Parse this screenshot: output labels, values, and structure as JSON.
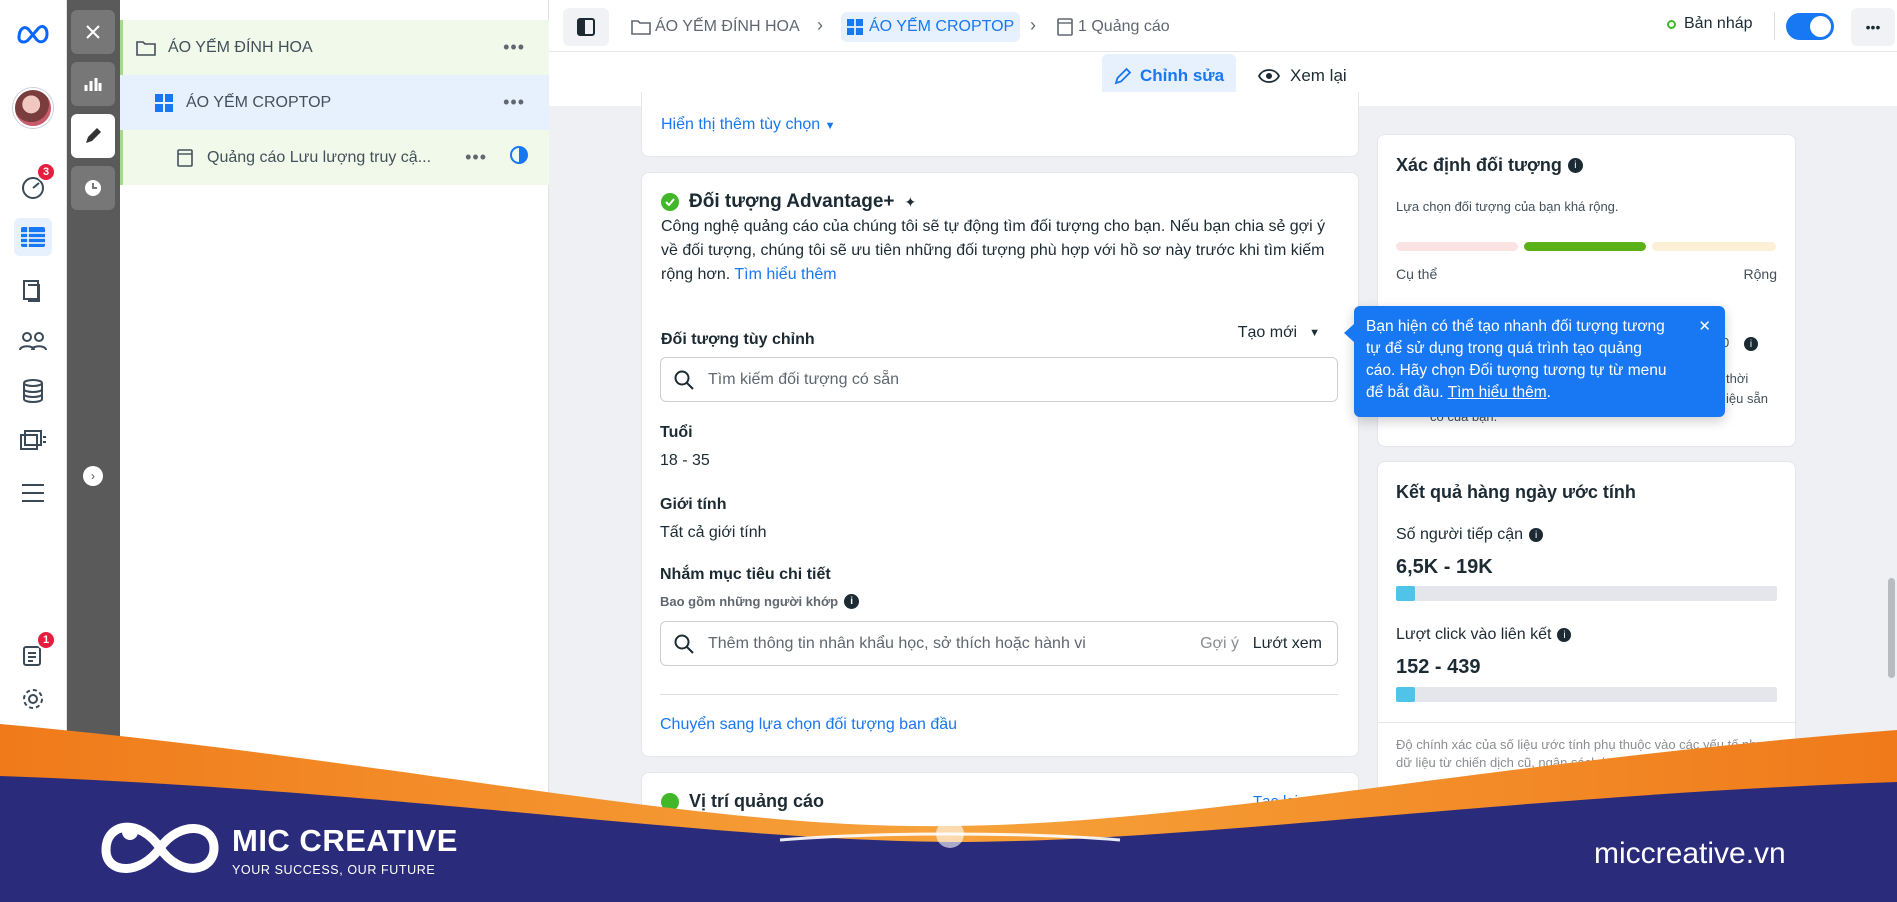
{
  "rail": {
    "notif_badge": "3",
    "bottom_badge": "1"
  },
  "tree": {
    "campaign": "ÁO YẾM ĐÍNH HOA",
    "adset": "ÁO YẾM CROPTOP",
    "ad": "Quảng cáo Lưu lượng truy cậ...",
    "dots": "•••"
  },
  "topbar": {
    "crumb_campaign": "ÁO YẾM ĐÍNH HOA",
    "crumb_adset": "ÁO YẾM CROPTOP",
    "crumb_ad": "1 Quảng cáo",
    "draft": "Bản nháp",
    "more": "•••"
  },
  "subbar": {
    "edit": "Chỉnh sửa",
    "preview": "Xem lại"
  },
  "main": {
    "show_more": "Hiển thị thêm tùy chọn",
    "advantage_title": "Đối tượng Advantage+",
    "advantage_desc": "Công nghệ quảng cáo của chúng tôi sẽ tự động tìm đối tượng cho bạn. Nếu bạn chia sẻ gợi ý về đối tượng, chúng tôi sẽ ưu tiên những đối tượng phù hợp với hồ sơ này trước khi tìm kiếm rộng hơn.",
    "learn_more": "Tìm hiểu thêm",
    "custom_audience": "Đối tượng tùy chỉnh",
    "create_new": "Tạo mới",
    "search_placeholder": "Tìm kiếm đối tượng có sẵn",
    "age_label": "Tuổi",
    "age_value": "18 - 35",
    "gender_label": "Giới tính",
    "gender_value": "Tất cả giới tính",
    "detailed_label": "Nhắm mục tiêu chi tiết",
    "detailed_sub": "Bao gồm những người khớp",
    "detailed_placeholder": "Thêm thông tin nhân khẩu học, sở thích hoặc hành vi",
    "suggest": "Gợi ý",
    "browse": "Lướt xem",
    "switch_link": "Chuyển sang lựa chọn đối tượng ban đầu",
    "placement_title": "Vị trí quảng cáo",
    "placement_right": "Tạo lại"
  },
  "audience_def": {
    "title": "Xác định đối tượng",
    "subtitle": "Lựa chọn đối tượng của bạn khá rộng.",
    "specific": "Cụ thể",
    "broad": "Rộng",
    "hidden_right_1": "0",
    "hidden_right_2": "thời",
    "hidden_right_3": "iệu sẵn",
    "hidden_left": "có của bạn."
  },
  "tooltip": {
    "text": "Bạn hiện có thể tạo nhanh đối tượng tương tự để sử dụng trong quá trình tạo quảng cáo. Hãy chọn Đối tượng tương tự từ menu để bắt đầu.",
    "link": "Tìm hiểu thêm",
    "close": "✕"
  },
  "results": {
    "title": "Kết quả hàng ngày ước tính",
    "reach_label": "Số người tiếp cận",
    "reach_value": "6,5K - 19K",
    "clicks_label": "Lượt click vào liên kết",
    "clicks_value": "152 - 439",
    "note": "Độ chính xác của số liệu ước tính phụ thuộc vào các yếu tố như dữ liệu từ chiến dịch cũ, ngân sách b... thị trường, tiêu..."
  },
  "banner": {
    "brand": "MIC CREATIVE",
    "tagline": "YOUR SUCCESS, OUR FUTURE",
    "website": "miccreative.vn"
  },
  "colors": {
    "accent": "#1877f2",
    "success": "#42b72a",
    "banner_navy": "#2a2a7a",
    "banner_orange": "#f08a1c"
  }
}
